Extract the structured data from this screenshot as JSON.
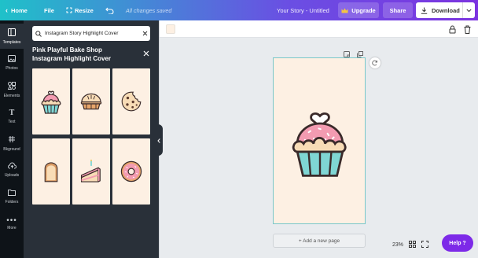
{
  "topbar": {
    "home_label": "Home",
    "file_label": "File",
    "resize_label": "Resize",
    "saved_status": "All changes saved",
    "doc_title": "Your Story - Untitled",
    "upgrade_label": "Upgrade",
    "share_label": "Share",
    "download_label": "Download"
  },
  "sidebar": {
    "items": [
      {
        "label": "Templates",
        "icon": "templates-icon"
      },
      {
        "label": "Photos",
        "icon": "photos-icon"
      },
      {
        "label": "Elements",
        "icon": "elements-icon"
      },
      {
        "label": "Text",
        "icon": "text-icon"
      },
      {
        "label": "Bkground",
        "icon": "background-icon"
      },
      {
        "label": "Uploads",
        "icon": "uploads-icon"
      },
      {
        "label": "Folders",
        "icon": "folders-icon"
      },
      {
        "label": "More",
        "icon": "more-icon"
      }
    ]
  },
  "panel": {
    "search_value": "Instagram Story Highlight Cover",
    "title_line1": "Pink Playful Bake Shop",
    "title_line2": "Instagram Highlight Cover",
    "thumbnails": [
      "cupcake",
      "pie",
      "cookie",
      "toast",
      "cake-slice",
      "donut"
    ]
  },
  "canvas": {
    "add_page_label": "+ Add a new page",
    "zoom_label": "23%"
  },
  "help_label": "Help ?",
  "colors": {
    "accent": "#7d2ae8",
    "teal": "#1fc1c9",
    "canvas_bg": "#fdf0e3",
    "panel_bg": "#293039",
    "rail_bg": "#0e1318"
  }
}
